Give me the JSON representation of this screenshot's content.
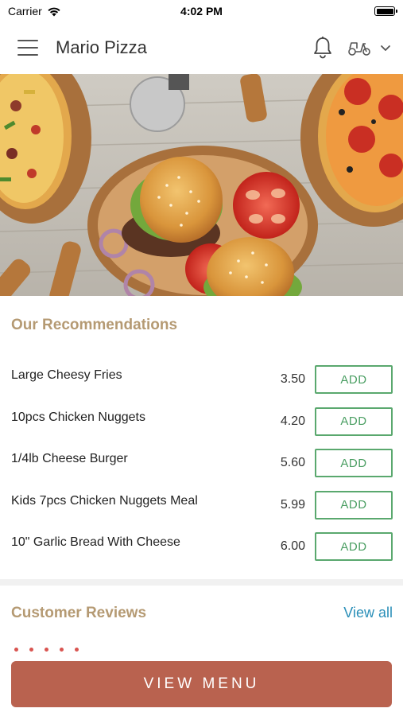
{
  "status_bar": {
    "carrier": "Carrier",
    "time": "4:02 PM"
  },
  "header": {
    "title": "Mario Pizza",
    "menu_icon": "hamburger-menu-icon",
    "notification_icon": "bell-icon",
    "delivery_icon": "scooter-icon",
    "dropdown_icon": "chevron-down-icon"
  },
  "hero": {
    "description_icon": "food-photo"
  },
  "recommendations": {
    "title": "Our Recommendations",
    "items": [
      {
        "name": "Large Cheesy Fries",
        "price": "3.50",
        "button": "ADD"
      },
      {
        "name": "10pcs Chicken Nuggets",
        "price": "4.20",
        "button": "ADD"
      },
      {
        "name": "1/4lb Cheese Burger",
        "price": "5.60",
        "button": "ADD"
      },
      {
        "name": "Kids 7pcs Chicken Nuggets Meal",
        "price": "5.99",
        "button": "ADD"
      },
      {
        "name": "10\" Garlic Bread With Cheese",
        "price": "6.00",
        "button": "ADD"
      }
    ]
  },
  "reviews": {
    "title": "Customer Reviews",
    "view_all": "View all"
  },
  "cta": {
    "view_menu": "VIEW MENU"
  },
  "colors": {
    "accent_gold": "#b59a73",
    "add_green": "#5aa86e",
    "link_blue": "#2a8fb8",
    "cta_terracotta": "#b9624f"
  }
}
